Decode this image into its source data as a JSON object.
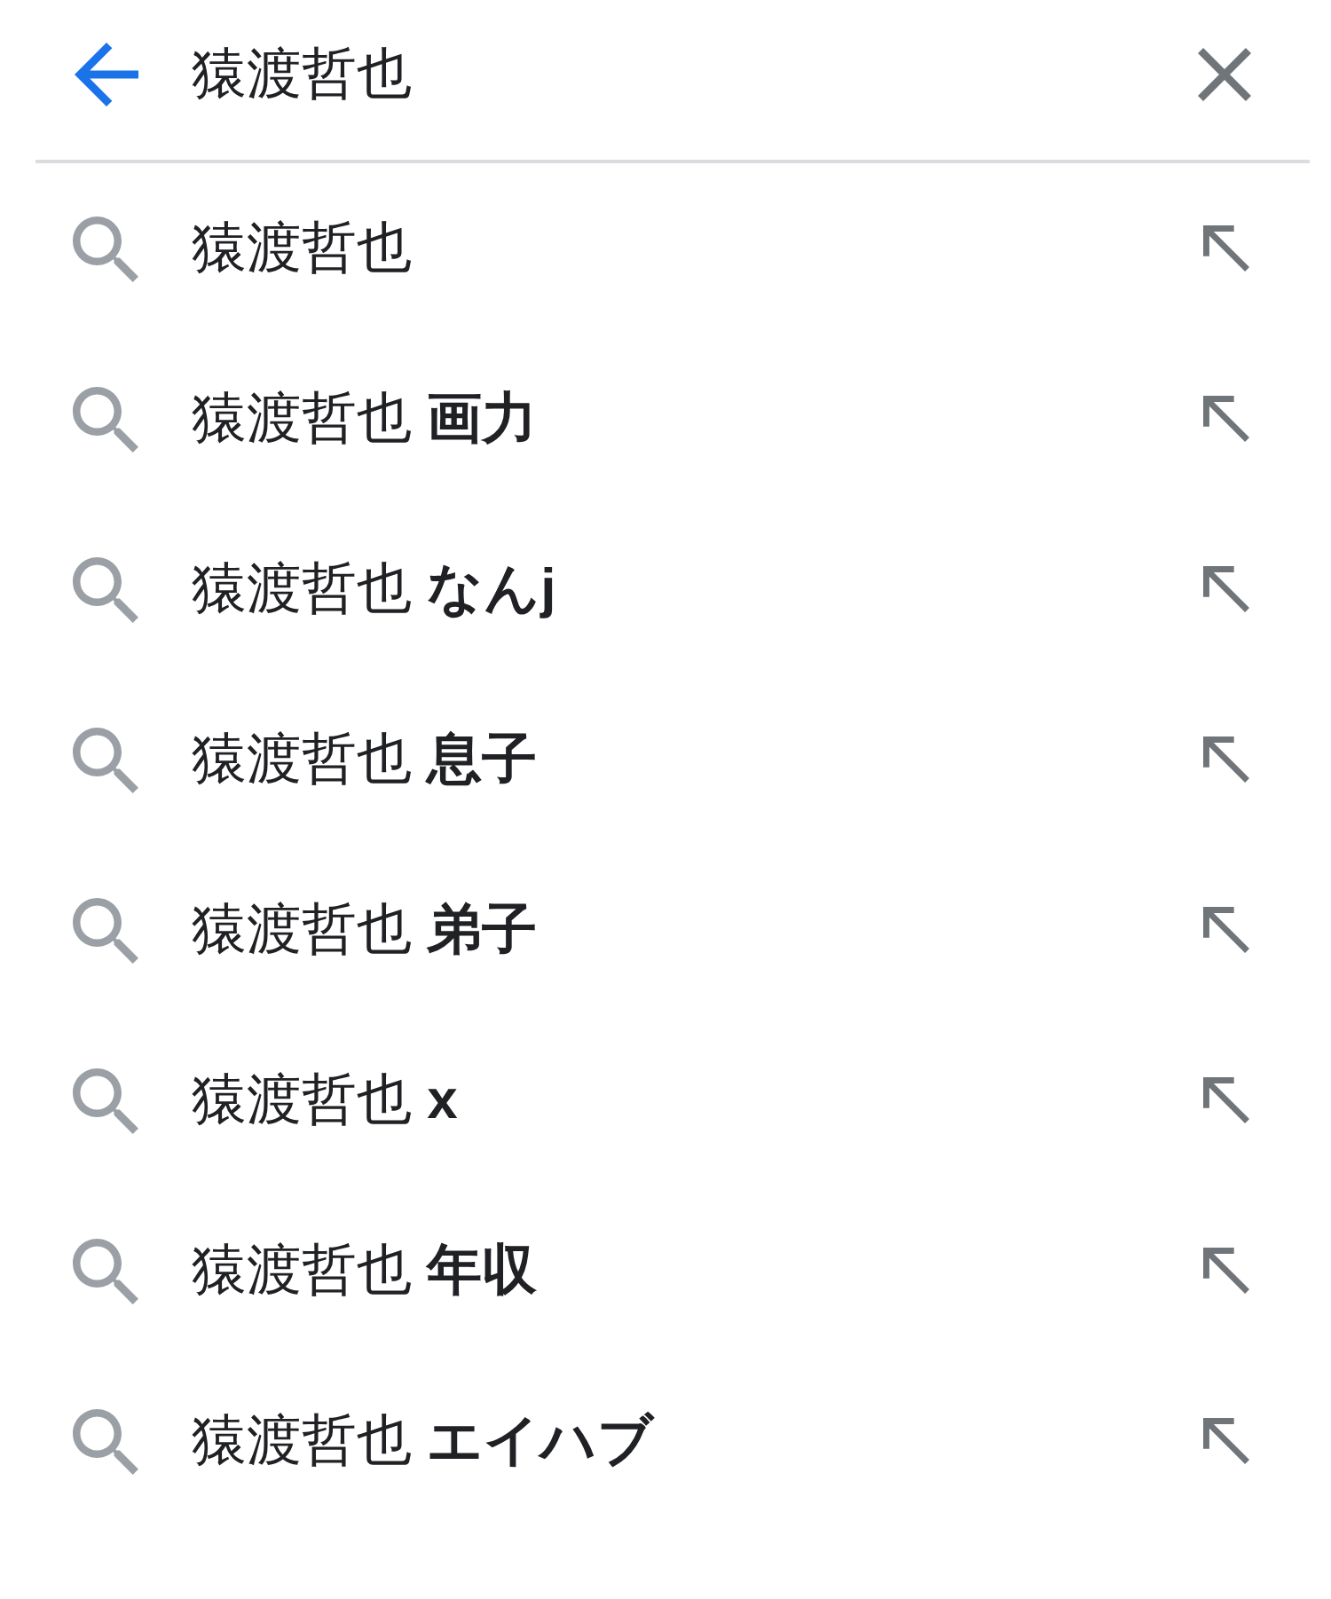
{
  "search": {
    "value": "猿渡哲也"
  },
  "suggestions": [
    "猿渡哲也",
    "猿渡哲也 **画力**",
    "猿渡哲也 **なんj**",
    "猿渡哲也 **息子**",
    "猿渡哲也 **弟子**",
    "猿渡哲也 **x**",
    "猿渡哲也 **年収**",
    "猿渡哲也 **エイハブ**"
  ]
}
